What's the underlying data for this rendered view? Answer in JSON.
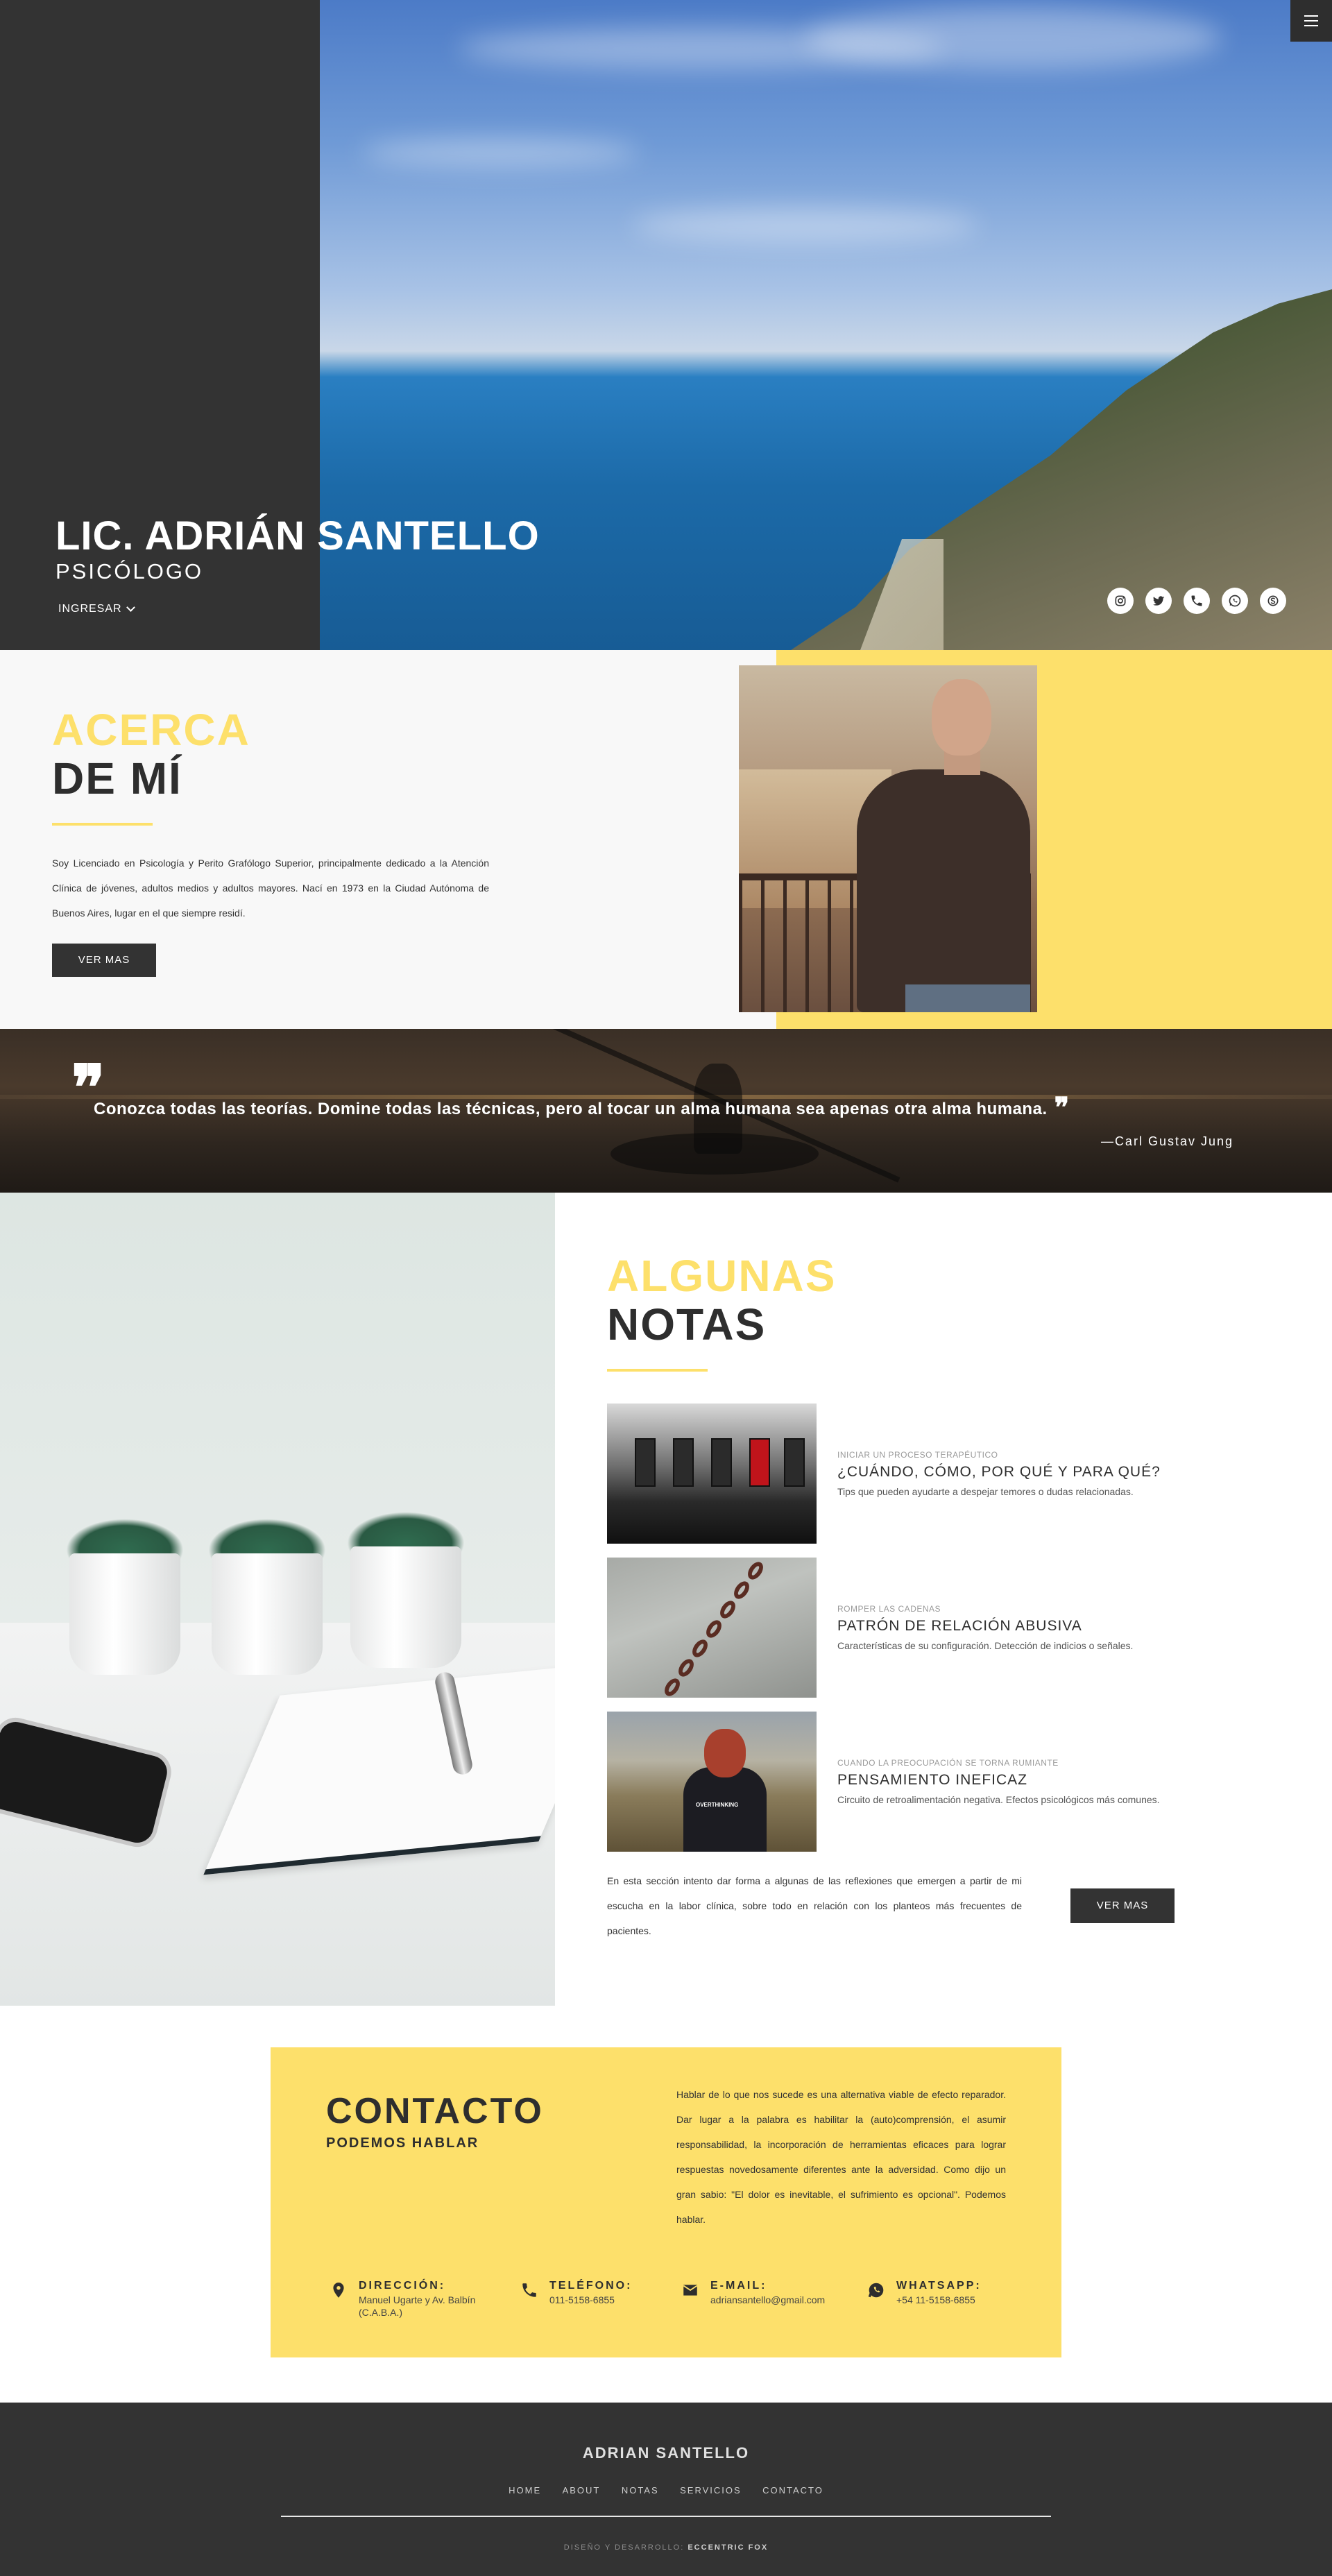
{
  "hero": {
    "name": "LIC. ADRIÁN SANTELLO",
    "role": "PSICÓLOGO",
    "enter_label": "INGRESAR",
    "social_icons": [
      "instagram-icon",
      "twitter-icon",
      "phone-icon",
      "whatsapp-icon",
      "skype-icon"
    ]
  },
  "about": {
    "title_line1": "ACERCA",
    "title_line2": "DE MÍ",
    "text": "Soy Licenciado en Psicología y Perito Grafólogo Superior, principalmente dedicado a la Atención Clínica de jóvenes, adultos medios y adultos mayores. Nací en 1973 en la Ciudad Autónoma de Buenos Aires, lugar en el que siempre residí.",
    "button": "VER MAS"
  },
  "quote": {
    "open_mark": "❞",
    "text": "Conozca todas las teorías. Domine todas las técnicas, pero al tocar un alma humana sea apenas otra alma humana.",
    "close_mark": "❞",
    "author": "—Carl Gustav Jung"
  },
  "notes": {
    "title_line1": "ALGUNAS",
    "title_line2": "NOTAS",
    "items": [
      {
        "kicker": "INICIAR UN PROCESO TERAPÉUTICO",
        "title": "¿CUÁNDO, CÓMO, POR QUÉ Y PARA QUÉ?",
        "desc": "Tips que pueden ayudarte a despejar temores o dudas relacionadas."
      },
      {
        "kicker": "ROMPER LAS CADENAS",
        "title": "PATRÓN DE RELACIÓN ABUSIVA",
        "desc": "Características de su configuración. Detección de indicios o señales."
      },
      {
        "kicker": "CUANDO LA PREOCUPACIÓN SE TORNA RUMIANTE",
        "title": "PENSAMIENTO INEFICAZ",
        "desc": "Circuito de retroalimentación negativa. Efectos psicológicos más comunes."
      }
    ],
    "thumb_text": "OVERTHINKING",
    "footer_text": "En esta sección intento dar forma a algunas de las reflexiones que emergen a partir de mi escucha en la labor clínica, sobre todo en relación con los planteos más frecuentes de pacientes.",
    "button": "VER MAS"
  },
  "contact": {
    "title": "CONTACTO",
    "subtitle": "PODEMOS HABLAR",
    "text": "Hablar de lo que nos sucede es una alternativa viable de efecto reparador. Dar lugar a la palabra es habilitar la (auto)comprensión, el asumir responsabilidad, la incorporación de herramientas eficaces para lograr respuestas novedosamente diferentes ante la adversidad. Como dijo un gran sabio: \"El dolor es inevitable, el sufrimiento es opcional\". Podemos hablar.",
    "items": [
      {
        "icon": "location-pin-icon",
        "label": "DIRECCIÓN:",
        "value": "Manuel Ugarte y Av. Balbín (C.A.B.A.)"
      },
      {
        "icon": "phone-icon",
        "label": "TELÉFONO:",
        "value": "011-5158-6855"
      },
      {
        "icon": "mail-icon",
        "label": "E-MAIL:",
        "value": "adriansantello@gmail.com"
      },
      {
        "icon": "whatsapp-icon",
        "label": "WHATSAPP:",
        "value": "+54 11-5158-6855"
      }
    ]
  },
  "footer": {
    "name": "ADRIAN SANTELLO",
    "nav": [
      "HOME",
      "ABOUT",
      "NOTAS",
      "SERVICIOS",
      "CONTACTO"
    ],
    "credit_prefix": "DISEÑO Y DESARROLLO:",
    "credit_name": "ECCENTRIC FOX"
  },
  "colors": {
    "accent_yellow": "#fde06b",
    "dark": "#333333"
  }
}
